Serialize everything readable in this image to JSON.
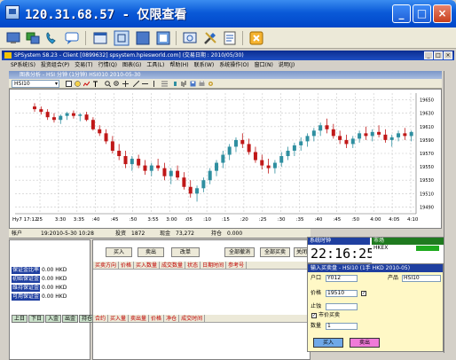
{
  "viewer": {
    "title": "120.31.68.57 - 仅限查看",
    "minimize": "_",
    "maximize": "□",
    "close": "×"
  },
  "app": {
    "title": "SPSystem S8.23 - Client [0899632] spsystem.hpiesworld.com] (交易日期 : 2010/05/30)",
    "menu": [
      "SP系统(S)",
      "投资组合(P)",
      "交易(T)",
      "行情(Q)",
      "图表(G)",
      "工具(L)",
      "帮助(H)",
      "联系(W)",
      "系统操作(O)",
      "窗口(N)",
      "说明(J)"
    ]
  },
  "chart": {
    "window_title": "图表分析 - HSI 分钟 (1分钟) HSI010 2010-05-30",
    "symbol": "HSI10",
    "footer_label": "Hy7 17:12",
    "x_ticks": [
      "25",
      "3:30",
      "3:35",
      ":40",
      ":45",
      ":50",
      "3:55",
      "3:00",
      ":05",
      ":10",
      ":15",
      ":20",
      ":25",
      ":30",
      ":35",
      ":40",
      ":45",
      ":50",
      "4:00",
      "4:05",
      "4:10"
    ],
    "y_ticks": [
      "19650",
      "19630",
      "19610",
      "19590",
      "19570",
      "19550",
      "19530",
      "19510",
      "19490"
    ]
  },
  "chart_data": {
    "type": "candlestick",
    "title": "",
    "xlabel": "",
    "ylabel": "",
    "ylim": [
      19480,
      19660
    ],
    "candles": [
      [
        19640,
        19645,
        19632,
        19636
      ],
      [
        19636,
        19640,
        19628,
        19632
      ],
      [
        19632,
        19636,
        19620,
        19624
      ],
      [
        19624,
        19630,
        19616,
        19620
      ],
      [
        19620,
        19628,
        19614,
        19626
      ],
      [
        19626,
        19632,
        19620,
        19630
      ],
      [
        19630,
        19634,
        19622,
        19626
      ],
      [
        19626,
        19630,
        19618,
        19628
      ],
      [
        19628,
        19632,
        19618,
        19620
      ],
      [
        19620,
        19624,
        19604,
        19606
      ],
      [
        19606,
        19612,
        19596,
        19600
      ],
      [
        19600,
        19606,
        19584,
        19588
      ],
      [
        19588,
        19596,
        19570,
        19574
      ],
      [
        19574,
        19584,
        19560,
        19566
      ],
      [
        19566,
        19574,
        19548,
        19554
      ],
      [
        19554,
        19566,
        19544,
        19562
      ],
      [
        19562,
        19568,
        19548,
        19552
      ],
      [
        19552,
        19560,
        19538,
        19544
      ],
      [
        19544,
        19556,
        19536,
        19552
      ],
      [
        19552,
        19562,
        19544,
        19548
      ],
      [
        19548,
        19556,
        19530,
        19536
      ],
      [
        19536,
        19548,
        19524,
        19544
      ],
      [
        19544,
        19552,
        19530,
        19534
      ],
      [
        19534,
        19542,
        19516,
        19520
      ],
      [
        19520,
        19530,
        19504,
        19510
      ],
      [
        19510,
        19522,
        19498,
        19518
      ],
      [
        19518,
        19534,
        19512,
        19530
      ],
      [
        19530,
        19548,
        19524,
        19544
      ],
      [
        19544,
        19560,
        19536,
        19556
      ],
      [
        19556,
        19574,
        19548,
        19568
      ],
      [
        19568,
        19584,
        19560,
        19580
      ],
      [
        19580,
        19594,
        19572,
        19590
      ],
      [
        19590,
        19600,
        19578,
        19584
      ],
      [
        19584,
        19592,
        19568,
        19572
      ],
      [
        19572,
        19580,
        19556,
        19560
      ],
      [
        19560,
        19568,
        19546,
        19552
      ],
      [
        19552,
        19562,
        19540,
        19548
      ],
      [
        19548,
        19560,
        19540,
        19556
      ],
      [
        19556,
        19572,
        19550,
        19566
      ],
      [
        19566,
        19580,
        19560,
        19574
      ],
      [
        19574,
        19586,
        19566,
        19582
      ],
      [
        19582,
        19594,
        19574,
        19588
      ],
      [
        19588,
        19600,
        19580,
        19596
      ],
      [
        19596,
        19608,
        19588,
        19604
      ],
      [
        19604,
        19616,
        19596,
        19612
      ],
      [
        19612,
        19622,
        19600,
        19606
      ],
      [
        19606,
        19614,
        19592,
        19596
      ],
      [
        19596,
        19604,
        19584,
        19590
      ],
      [
        19590,
        19598,
        19578,
        19584
      ],
      [
        19584,
        19596,
        19578,
        19592
      ],
      [
        19592,
        19604,
        19586,
        19600
      ],
      [
        19600,
        19610,
        19590,
        19596
      ],
      [
        19596,
        19606,
        19588,
        19602
      ],
      [
        19602,
        19612,
        19594,
        19598
      ],
      [
        19598,
        19606,
        19586,
        19590
      ],
      [
        19590,
        19598,
        19580,
        19594
      ],
      [
        19594,
        19604,
        19588,
        19600
      ],
      [
        19600,
        19608,
        19590,
        19596
      ],
      [
        19596,
        19604,
        19588,
        19602
      ]
    ],
    "colors": {
      "up": "#2f8fa0",
      "down": "#c01818"
    }
  },
  "account": {
    "header": [
      "帐户",
      "19:2010-5-30 10:28",
      "投资",
      "1872",
      "现金",
      "73,272",
      "持仓",
      "0.000"
    ],
    "stats": [
      {
        "label": "保证金比率",
        "value": "0.00 HKD"
      },
      {
        "label": "初始保证金",
        "value": "0.00 HKD"
      },
      {
        "label": "维持保证金",
        "value": "0.00 HKD"
      },
      {
        "label": "可用保证金",
        "value": "0.00 HKD"
      }
    ],
    "tabs": [
      "上日",
      "下日",
      "入金",
      "出金",
      "持仓"
    ]
  },
  "orders": {
    "buttons": [
      "买入",
      "卖出",
      "改单",
      "全部撤消",
      "全部买卖",
      "关闭"
    ],
    "columns": [
      "买卖方向",
      "价格",
      "买入数量",
      "成交数量",
      "状态",
      "日期时间",
      "参考号"
    ],
    "trade_columns": [
      "合约",
      "买入量",
      "卖出量",
      "价格",
      "净仓",
      "成交时间"
    ]
  },
  "clock": {
    "title": "系统时钟",
    "time": "22:16:25",
    "market_head": "市场",
    "market_name": "HKEX"
  },
  "entry": {
    "title": "输入买卖盘 - HSI10 (1手 HKD 2010-05)",
    "account_label": "户口",
    "account_value": "Y012",
    "product_label": "产品",
    "product_value": "HSI10",
    "price_label": "价格",
    "price_value": "19510",
    "qty_label": "数量",
    "qty_value": "1",
    "stop_label": "止蚀",
    "market_price_label": "市价买卖",
    "buy_label": "买入",
    "sell_label": "卖出"
  }
}
